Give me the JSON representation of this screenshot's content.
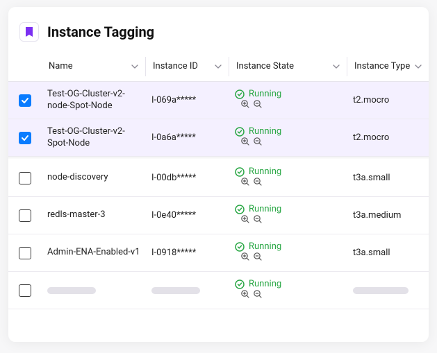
{
  "title": "Instance Tagging",
  "columns": {
    "name": "Name",
    "instance_id": "Instance ID",
    "instance_state": "Instance State",
    "instance_type": "Instance Type"
  },
  "status_label": "Running",
  "rows": [
    {
      "selected": true,
      "name": "Test-OG-Cluster-v2-node-Spot-Node",
      "instance_id": "I-069a*****",
      "state": "Running",
      "type": "t2.mocro"
    },
    {
      "selected": true,
      "name": "Test-OG-Cluster-v2-Spot-Node",
      "instance_id": "I-0a6a*****",
      "state": "Running",
      "type": "t2.mocro"
    },
    {
      "selected": false,
      "name": "node-discovery",
      "instance_id": "I-00db*****",
      "state": "Running",
      "type": "t3a.small"
    },
    {
      "selected": false,
      "name": "redls-master-3",
      "instance_id": "I-0e40*****",
      "state": "Running",
      "type": "t3a.medium"
    },
    {
      "selected": false,
      "name": "Admin-ENA-Enabled-v1",
      "instance_id": "I-0918*****",
      "state": "Running",
      "type": "t3a.small"
    },
    {
      "selected": false,
      "name": null,
      "instance_id": null,
      "state": "Running",
      "type": null
    }
  ]
}
